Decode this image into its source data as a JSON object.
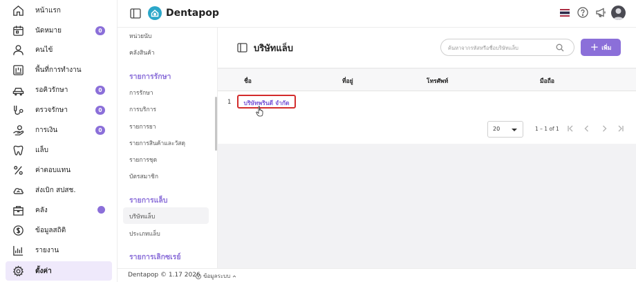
{
  "app": {
    "brand": "Dentapop"
  },
  "sidebar": {
    "items": [
      {
        "label": "หน้าแรก",
        "icon": "home-icon"
      },
      {
        "label": "นัดหมาย",
        "icon": "calendar-icon",
        "badge": "0"
      },
      {
        "label": "คนไข้",
        "icon": "user-icon"
      },
      {
        "label": "พื้นที่การทำงาน",
        "icon": "workspace-icon"
      },
      {
        "label": "รอคิวรักษา",
        "icon": "queue-icon",
        "badge": "0"
      },
      {
        "label": "ตรวจรักษา",
        "icon": "treatment-icon",
        "badge": "0"
      },
      {
        "label": "การเงิน",
        "icon": "finance-icon",
        "badge": "0"
      },
      {
        "label": "แล็บ",
        "icon": "tooth-icon"
      },
      {
        "label": "ค่าตอบแทน",
        "icon": "percent-icon"
      },
      {
        "label": "ส่งเบิก สปสช.",
        "icon": "cloud-icon"
      },
      {
        "label": "คลัง",
        "icon": "inventory-icon",
        "dot": true
      },
      {
        "label": "ข้อมูลสถิติ",
        "icon": "statistics-icon"
      },
      {
        "label": "รายงาน",
        "icon": "report-icon"
      },
      {
        "label": "ตั้งค่า",
        "icon": "gear-icon",
        "active": true
      }
    ]
  },
  "submenu": {
    "top_items": [
      "หน่วยนับ",
      "คลังสินค้า"
    ],
    "treatment_heading": "รายการรักษา",
    "treatment_items": [
      "การรักษา",
      "การบริการ",
      "รายการยา",
      "รายการสินค้าและวัสดุ",
      "รายการชุด",
      "บัตรสมาชิก"
    ],
    "lab_heading": "รายการแล็บ",
    "lab_items": [
      "บริษัทแล็บ",
      "ประเภทแล็บ"
    ],
    "bottom_heading": "รายการเลิกซเรย์"
  },
  "page": {
    "title": "บริษัทแล็บ",
    "search_placeholder": "ค้นหาจากรหัสหรือชื่อบริษัทแล็บ",
    "add_label": "เพิ่ม"
  },
  "table": {
    "columns": [
      "ชื่อ",
      "ที่อยู่",
      "โทรศัพท์",
      "มือถือ"
    ],
    "rows": [
      {
        "no": "1",
        "name": "บริษัทพรินดี จำกัด"
      }
    ]
  },
  "pagination": {
    "page_size": "20",
    "range": "1 – 1 of 1"
  },
  "footer": {
    "text": "Dentapop © 1.17 2026",
    "link": "ข้อมูลระบบ"
  },
  "colors": {
    "accent": "#8b6fd9",
    "logo": "#2ba7c9",
    "highlight": "#d32b2b"
  }
}
